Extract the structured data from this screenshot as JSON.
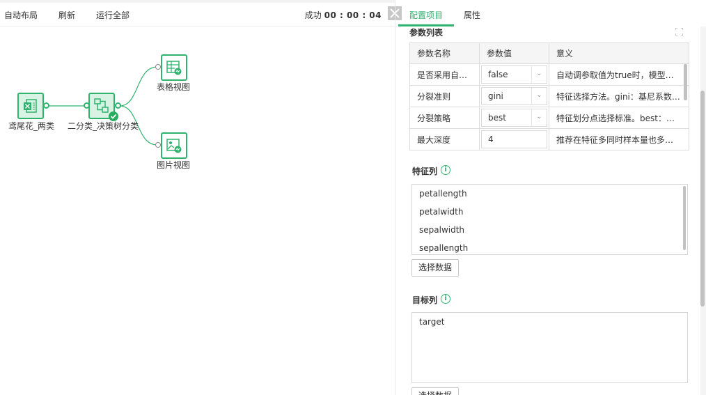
{
  "toolbar": {
    "auto_layout": "自动布局",
    "refresh": "刷新",
    "run_all": "运行全部",
    "status_label": "成功",
    "elapsed": "00 : 00 : 04"
  },
  "tabs": [
    {
      "label": "配置项目",
      "active": true
    },
    {
      "label": "属性",
      "active": false
    }
  ],
  "canvas": {
    "nodes": [
      {
        "label": "鸢尾花_两类",
        "icon": "excel-dataset-icon"
      },
      {
        "label": "二分类_决策树分类",
        "icon": "decision-tree-icon",
        "status": "success"
      },
      {
        "label": "表格视图",
        "icon": "table-view-icon"
      },
      {
        "label": "图片视图",
        "icon": "image-view-icon"
      }
    ]
  },
  "param_section": {
    "title": "参数列表",
    "columns": [
      "参数名称",
      "参数值",
      "意义"
    ],
    "rows": [
      {
        "name": "是否采用自动...",
        "value": "false",
        "type": "select",
        "desc": "自动调参取值为true时，模型自动..."
      },
      {
        "name": "分裂准则",
        "value": "gini",
        "type": "select",
        "desc": "特征选择方法。gini：基尼系数，..."
      },
      {
        "name": "分裂策略",
        "value": "best",
        "type": "select",
        "desc": "特征划分点选择标准。best：在所..."
      },
      {
        "name": "最大深度",
        "value": "4",
        "type": "input",
        "desc": "推荐在特征多同时样本量也多时，..."
      }
    ]
  },
  "feature_section": {
    "title": "特征列",
    "items": [
      "petallength",
      "petalwidth",
      "sepalwidth",
      "sepallength"
    ],
    "button": "选择数据"
  },
  "target_section": {
    "title": "目标列",
    "items": [
      "target"
    ],
    "button": "选择数据"
  },
  "colors": {
    "accent": "#2db36d",
    "node_fill": "#d8f3e3",
    "success": "#27ae60"
  }
}
